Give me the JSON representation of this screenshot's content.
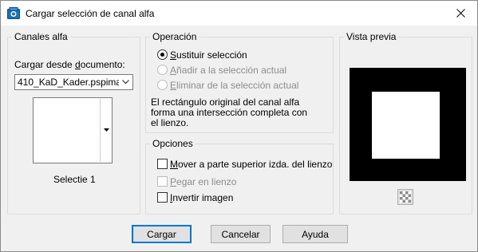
{
  "window": {
    "title": "Cargar selección de canal alfa"
  },
  "channels_group": {
    "label": "Canales alfa",
    "load_from_label_pre": "Cargar desde ",
    "load_from_label_ul": "d",
    "load_from_label_post": "ocumento:",
    "document_value": "410_KaD_Kader.pspimage",
    "channel_name": "Selectie 1"
  },
  "operation_group": {
    "label": "Operación",
    "options": [
      {
        "ul": "S",
        "rest": "ustituir selección",
        "selected": true,
        "enabled": true
      },
      {
        "ul": "A",
        "rest": "ñadir a la selección actual",
        "selected": false,
        "enabled": false
      },
      {
        "ul": "E",
        "rest": "liminar de la selección actual",
        "selected": false,
        "enabled": false
      }
    ],
    "description_line1": "El rectángulo original del canal alfa",
    "description_line2": "forma una intersección completa con",
    "description_line3": "el lienzo."
  },
  "options_group": {
    "label": "Opciones",
    "checkboxes": [
      {
        "ul": "M",
        "rest": "over a parte superior izda. del lienzo",
        "checked": false,
        "enabled": true
      },
      {
        "ul": "P",
        "rest": "egar en lienzo",
        "checked": false,
        "enabled": false
      },
      {
        "ul": "I",
        "rest": "nvertir imagen",
        "checked": false,
        "enabled": true
      }
    ]
  },
  "preview_group": {
    "label": "Vista previa",
    "zoom_icon": "checker-icon"
  },
  "buttons": {
    "load": "Cargar",
    "cancel": "Cancelar",
    "help": "Ayuda"
  },
  "colors": {
    "dialog_bg": "#f0f0f0",
    "titlebar_bg": "#ffffff",
    "accent": "#0078d7",
    "disabled_text": "#8d8d8d"
  }
}
